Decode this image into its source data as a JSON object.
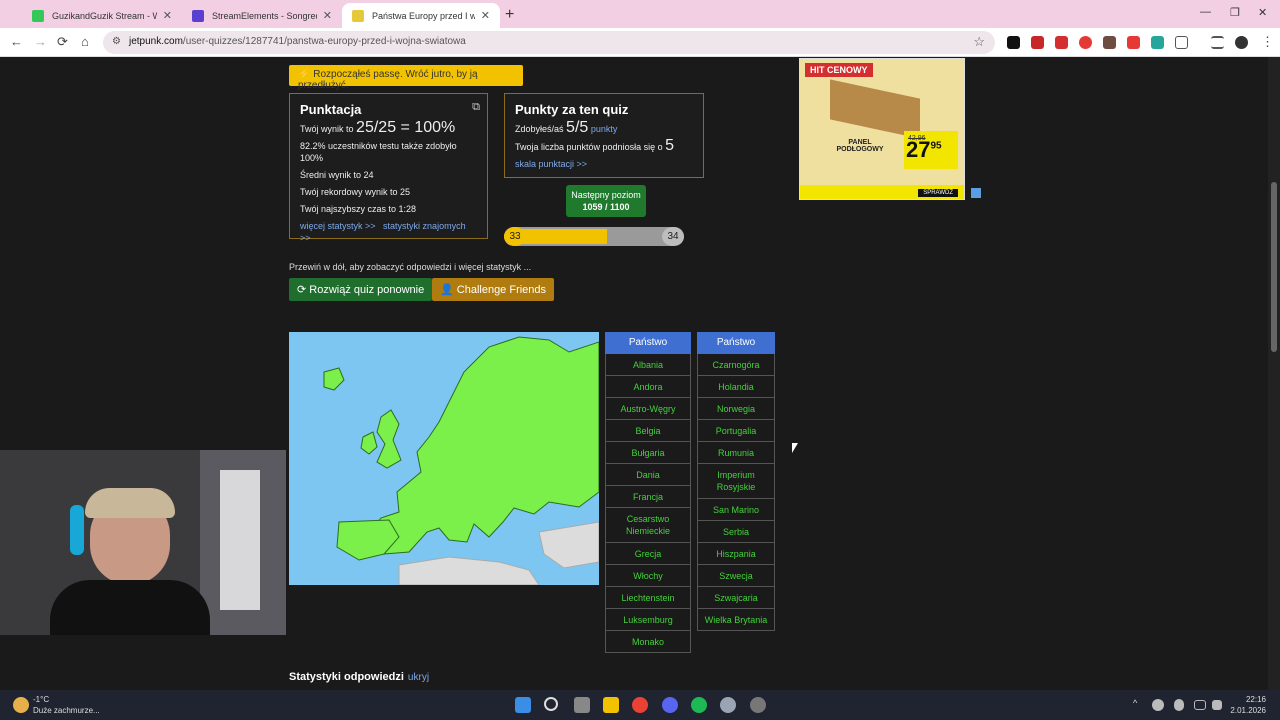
{
  "tabs": [
    {
      "title": "GuzikandGuzik Stream - Watch",
      "color": "#34c759"
    },
    {
      "title": "StreamElements - Songrequest",
      "color": "#5b3fd1"
    },
    {
      "title": "Państwa Europy przed I wojną św",
      "color": "#e6c93a"
    }
  ],
  "address": {
    "domain": "jetpunk.com",
    "path": "/user-quizzes/1287741/panstwa-europy-przed-i-wojna-swiatowa"
  },
  "notice": "⚡ Rozpocząłeś passę. Wróć jutro, by ją przedłużyć.",
  "score": {
    "title": "Punktacja",
    "result_prefix": "Twój wynik to",
    "result_value": "25/25 = 100%",
    "percent_line": "82.2% uczestników testu także zdobyło 100%",
    "average": "Średni wynik to 24",
    "record": "Twój rekordowy wynik to 25",
    "fastest": "Twój najszybszy czas to 1:28",
    "link_more": "więcej statystyk >>",
    "link_friends": "statystyki znajomych >>"
  },
  "points": {
    "title": "Punkty za ten quiz",
    "earned_prefix": "Zdobyłeś/aś",
    "earned_value": "5/5",
    "earned_suffix": "punkty",
    "increase_text": "Twoja liczba punktów podniosła się o",
    "increase_value": "5",
    "scale_link": "skala punktacji >>"
  },
  "level": {
    "label": "Następny poziom",
    "value": "1059 / 1100",
    "current": "33",
    "next": "34",
    "progress": 0.57
  },
  "hint": "Przewiń w dół, aby zobaczyć odpowiedzi i więcej statystyk ...",
  "buttons": {
    "retry": "⟳ Rozwiąż quiz ponownie",
    "challenge": "Challenge Friends"
  },
  "table_header": "Państwo",
  "col1": [
    "Albania",
    "Andora",
    "Austro-Węgry",
    "Belgia",
    "Bułgaria",
    "Dania",
    "Francja",
    "Cesarstwo Niemieckie",
    "Grecja",
    "Włochy",
    "Liechtenstein",
    "Luksemburg",
    "Monako"
  ],
  "col2": [
    "Czarnogóra",
    "Holandia",
    "Norwegia",
    "Portugalia",
    "Rumunia",
    "Imperium Rosyjskie",
    "San Marino",
    "Serbia",
    "Hiszpania",
    "Szwecja",
    "Szwajcaria",
    "Wielka Brytania"
  ],
  "stats_title": "Statystyki odpowiedzi",
  "stats_hide": "ukryj",
  "ad": {
    "badge": "HIT CENOWY",
    "product": "PANEL PODŁOGOWY",
    "price_int": "27",
    "price_dec": "95",
    "button": "SPRAWDŹ",
    "old_price": "42,96"
  },
  "weather": {
    "temp": "-1°C",
    "desc": "Duże zachmurze..."
  },
  "clock": {
    "time": "22:16",
    "date": "2.01.2026"
  }
}
